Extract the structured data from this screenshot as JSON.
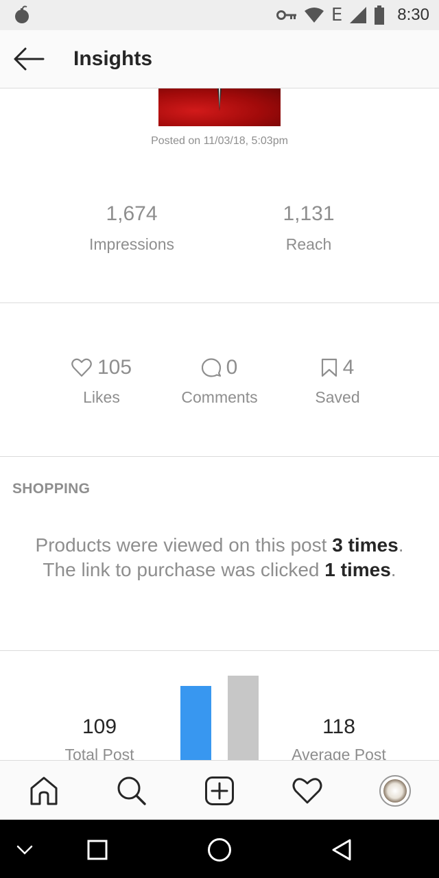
{
  "status_bar": {
    "network_type": "E",
    "time": "8:30",
    "icons": [
      "bomb-icon",
      "key-icon",
      "wifi-icon",
      "signal-icon",
      "battery-icon"
    ]
  },
  "header": {
    "title": "Insights",
    "back_icon": "back-arrow-icon"
  },
  "post": {
    "posted_on": "Posted on 11/03/18, 5:03pm"
  },
  "overview": {
    "impressions": {
      "value": "1,674",
      "label": "Impressions"
    },
    "reach": {
      "value": "1,131",
      "label": "Reach"
    }
  },
  "engagement": {
    "likes": {
      "value": "105",
      "label": "Likes",
      "icon": "heart-icon"
    },
    "comments": {
      "value": "0",
      "label": "Comments",
      "icon": "comment-icon"
    },
    "saved": {
      "value": "4",
      "label": "Saved",
      "icon": "bookmark-icon"
    }
  },
  "shopping": {
    "title": "SHOPPING",
    "text_1": "Products were viewed on this post ",
    "views": "3 times",
    "text_2": ". The link to purchase was clicked ",
    "clicks": "1 times",
    "text_3": "."
  },
  "comparison": {
    "this_post": {
      "value": "109",
      "label": "Total Post"
    },
    "average": {
      "value": "118",
      "label": "Average Post"
    },
    "colors": {
      "this_post": "#3897f0",
      "average": "#c7c7c7"
    }
  },
  "tab_bar": {
    "items": [
      "home-icon",
      "search-icon",
      "add-post-icon",
      "activity-heart-icon",
      "profile-avatar"
    ]
  },
  "nav_bar": {
    "items": [
      "collapse-chevron-icon",
      "recents-square-icon",
      "home-circle-icon",
      "back-triangle-icon"
    ]
  }
}
